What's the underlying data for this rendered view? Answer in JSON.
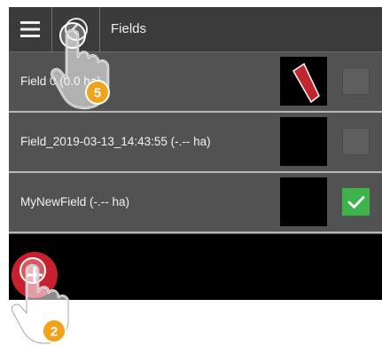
{
  "header": {
    "title": "Fields",
    "menu_icon": "hamburger-menu-icon",
    "back_icon": "back-arrow-icon"
  },
  "fields": [
    {
      "label": "Field 0 (0.0 ha)",
      "checked": false,
      "has_shape": true
    },
    {
      "label": "Field_2019-03-13_14:43:55 (-.-- ha)",
      "checked": false,
      "has_shape": false
    },
    {
      "label": "MyNewField (-.-- ha)",
      "checked": true,
      "has_shape": false
    }
  ],
  "add_button": {
    "icon": "add-plus-icon",
    "color": "#c7212f"
  },
  "annotations": {
    "step_top": "5",
    "step_bottom": "2",
    "badge_color": "#f1a31b"
  },
  "colors": {
    "topbar": "#3b3b3b",
    "list_bg": "#525252",
    "check_active": "#3eb34a",
    "shape": "#c0262b"
  }
}
